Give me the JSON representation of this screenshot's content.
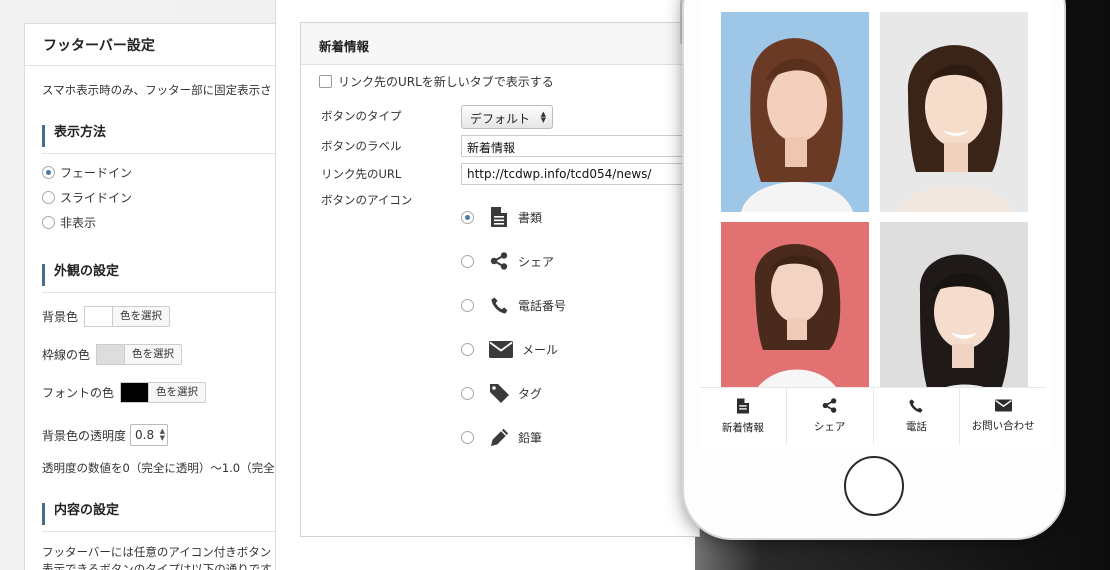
{
  "left_panel": {
    "title": "フッターバー設定",
    "description": "スマホ表示時のみ、フッター部に固定表示さ",
    "display_method": {
      "heading": "表示方法",
      "options": [
        {
          "label": "フェードイン",
          "selected": true
        },
        {
          "label": "スライドイン",
          "selected": false
        },
        {
          "label": "非表示",
          "selected": false
        }
      ]
    },
    "appearance": {
      "heading": "外観の設定",
      "bg_color_label": "背景色",
      "border_color_label": "枠線の色",
      "font_color_label": "フォントの色",
      "pick_label": "色を選択",
      "bg_color": "#ffffff",
      "border_color": "#dddddd",
      "font_color": "#000000",
      "opacity_label": "背景色の透明度",
      "opacity_value": "0.8",
      "opacity_note": "透明度の数値を0（完全に透明）〜1.0（完全"
    },
    "content": {
      "heading": "内容の設定",
      "text1": "フッターバーには任意のアイコン付きボタン",
      "text2": "表示できるボタンのタイプは以下の通りです"
    }
  },
  "news_box": {
    "title": "新着情報",
    "new_tab_label": "リンク先のURLを新しいタブで表示する",
    "type_label": "ボタンのタイプ",
    "type_value": "デフォルト",
    "label_label": "ボタンのラベル",
    "label_value": "新着情報",
    "url_label": "リンク先のURL",
    "url_value": "http://tcdwp.info/tcd054/news/",
    "icon_label": "ボタンのアイコン",
    "icons": [
      {
        "name": "書類",
        "icon": "file-icon",
        "selected": true
      },
      {
        "name": "シェア",
        "icon": "share-icon",
        "selected": false
      },
      {
        "name": "電話番号",
        "icon": "phone-icon",
        "selected": false
      },
      {
        "name": "メール",
        "icon": "envelope-icon",
        "selected": false
      },
      {
        "name": "タグ",
        "icon": "tag-icon",
        "selected": false
      },
      {
        "name": "鉛筆",
        "icon": "pencil-icon",
        "selected": false
      }
    ]
  },
  "phone": {
    "footer_buttons": [
      {
        "label": "新着情報",
        "icon": "file-icon"
      },
      {
        "label": "シェア",
        "icon": "share-icon"
      },
      {
        "label": "電話",
        "icon": "phone-icon"
      },
      {
        "label": "お問い合わせ",
        "icon": "envelope-icon"
      }
    ],
    "photo_backgrounds": [
      "#9ec6e6",
      "#e8e8e8",
      "#e27272",
      "#dedede"
    ]
  },
  "colors": {
    "accent": "#4c7aa8",
    "heading_bar": "#4b6b8c"
  }
}
